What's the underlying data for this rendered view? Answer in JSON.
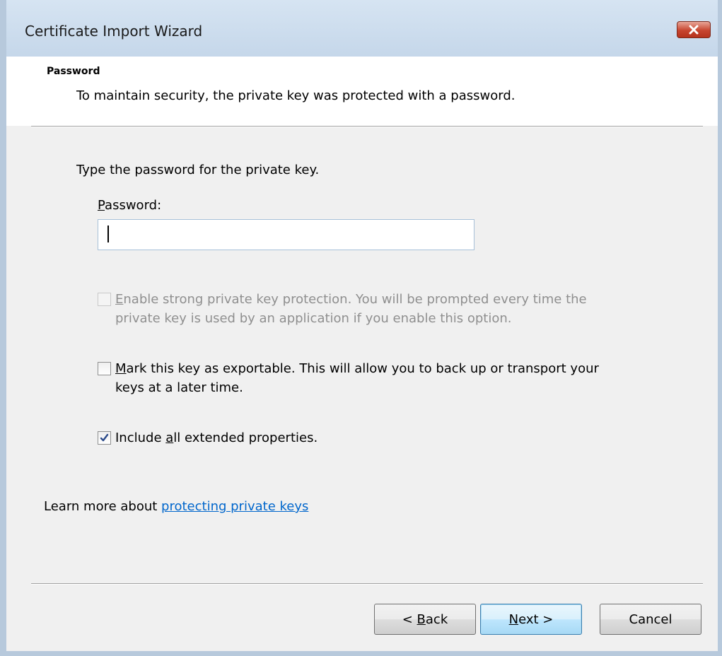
{
  "window": {
    "title": "Certificate Import Wizard",
    "close_icon": "close-icon"
  },
  "header": {
    "section_title": "Password",
    "description": "To maintain security, the private key was protected with a password."
  },
  "body": {
    "prompt": "Type the password for the private key.",
    "password_label_mnemonic": "P",
    "password_label_rest": "assword:",
    "password_value": ""
  },
  "options": [
    {
      "mnemonic": "E",
      "label_rest": "nable strong private key protection. You will be prompted every time the",
      "label_line2": "private key is used by an application if you enable this option.",
      "checked": false,
      "enabled": false
    },
    {
      "mnemonic": "M",
      "label_rest": "ark this key as exportable. This will allow you to back up or transport your",
      "label_line2": "keys at a later time.",
      "checked": false,
      "enabled": true
    },
    {
      "label_pre": "Include ",
      "mnemonic": "a",
      "label_rest": "ll extended properties.",
      "checked": true,
      "enabled": true
    }
  ],
  "learn_more": {
    "prefix": "Learn more about ",
    "link_text": "protecting private keys"
  },
  "buttons": {
    "back_pre": "< ",
    "back_mnemonic": "B",
    "back_rest": "ack",
    "next_mnemonic": "N",
    "next_rest": "ext >",
    "cancel": "Cancel"
  },
  "colors": {
    "link": "#0066cc",
    "close_button": "#c7452f",
    "check_mark": "#2b4a8a"
  }
}
